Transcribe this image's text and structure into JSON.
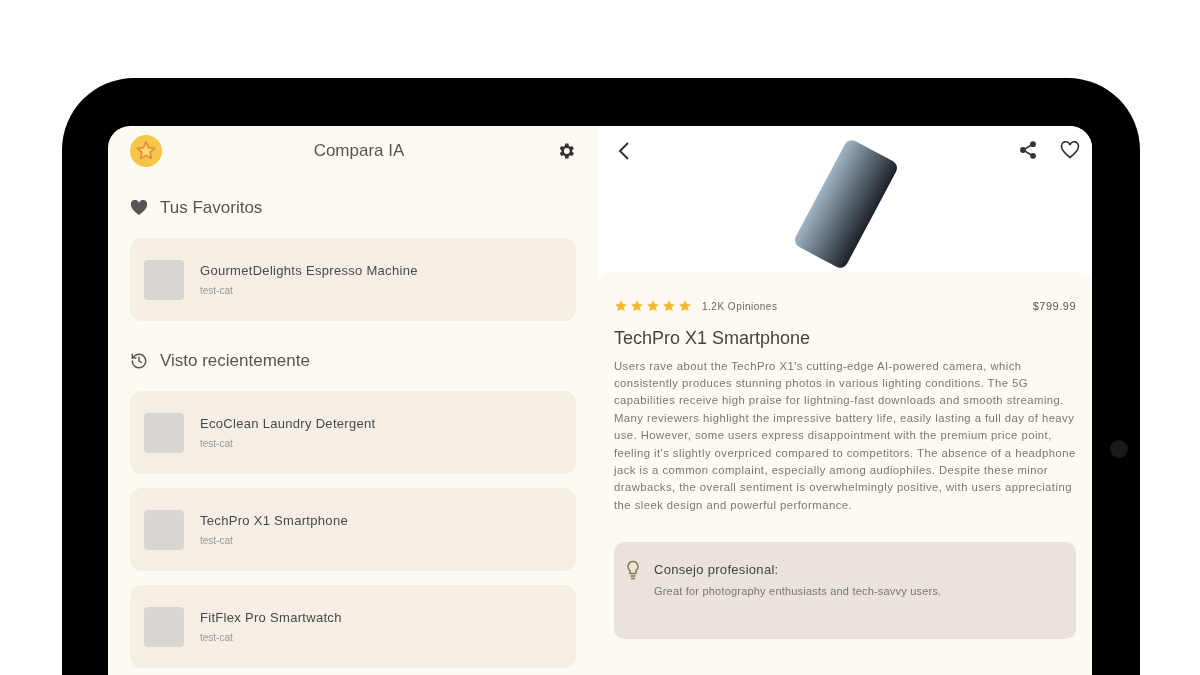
{
  "app": {
    "title": "Compara IA"
  },
  "favorites": {
    "heading": "Tus Favoritos",
    "items": [
      {
        "name": "GourmetDelights Espresso Machine",
        "category": "test-cat"
      }
    ]
  },
  "recent": {
    "heading": "Visto recientemente",
    "items": [
      {
        "name": "EcoClean Laundry Detergent",
        "category": "test-cat"
      },
      {
        "name": "TechPro X1 Smartphone",
        "category": "test-cat"
      },
      {
        "name": "FitFlex Pro Smartwatch",
        "category": "test-cat"
      }
    ]
  },
  "detail": {
    "stars": 5,
    "reviews": "1.2K Opiniones",
    "price": "$799.99",
    "title": "TechPro X1 Smartphone",
    "summary": "Users rave about the TechPro X1's cutting-edge AI-powered camera, which consistently produces stunning photos in various lighting conditions. The 5G capabilities receive high praise for lightning-fast downloads and smooth streaming. Many reviewers highlight the impressive battery life, easily lasting a full day of heavy use. However, some users express disappointment with the premium price point, feeling it's slightly overpriced compared to competitors. The absence of a headphone jack is a common complaint, especially among audiophiles. Despite these minor drawbacks, the overall sentiment is overwhelmingly positive, with users appreciating the sleek design and powerful performance.",
    "tip": {
      "label": "Consejo profesional:",
      "text": "Great for photography enthusiasts and tech-savvy users."
    }
  }
}
